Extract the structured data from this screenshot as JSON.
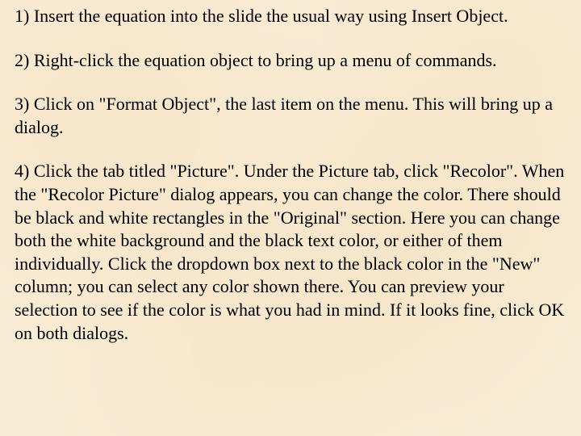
{
  "steps": [
    {
      "num": "1)",
      "text": "Insert the equation into the slide the usual way using Insert Object."
    },
    {
      "num": "2)",
      "text": "Right-click the equation object to bring up a menu of commands."
    },
    {
      "num": "3)",
      "text": "Click on \"Format Object\", the last item on the menu. This will bring up a dialog."
    },
    {
      "num": "4)",
      "text": " Click the tab titled \"Picture\". Under the Picture tab, click \"Recolor\". When the \"Recolor Picture\" dialog appears, you can change the color. There should be black and white rectangles in the \"Original\" section. Here you can change both the white background and the black text color, or either of them individually. Click the dropdown box next to the black color in the \"New\" column; you can select any color shown there. You can preview your selection to see if the color is what you had in mind. If it looks fine, click OK on both dialogs."
    }
  ]
}
